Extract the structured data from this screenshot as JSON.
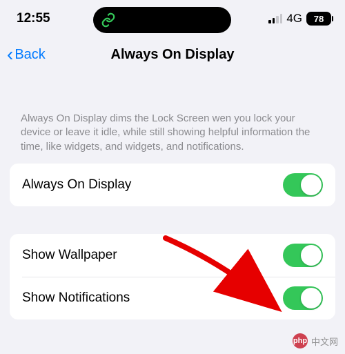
{
  "status": {
    "time": "12:55",
    "network": "4G",
    "battery": "78"
  },
  "nav": {
    "back": "Back",
    "title": "Always On Display"
  },
  "description": "Always On Display dims the Lock Screen wen you lock your device or leave it idle, while still showing helpful information the time, like widgets, and widgets, and notifications.",
  "rows": {
    "aod": {
      "label": "Always On Display",
      "on": true
    },
    "wallpaper": {
      "label": "Show Wallpaper",
      "on": true
    },
    "notifications": {
      "label": "Show Notifications",
      "on": true
    }
  },
  "watermark": {
    "logo": "php",
    "text": "中文网"
  }
}
